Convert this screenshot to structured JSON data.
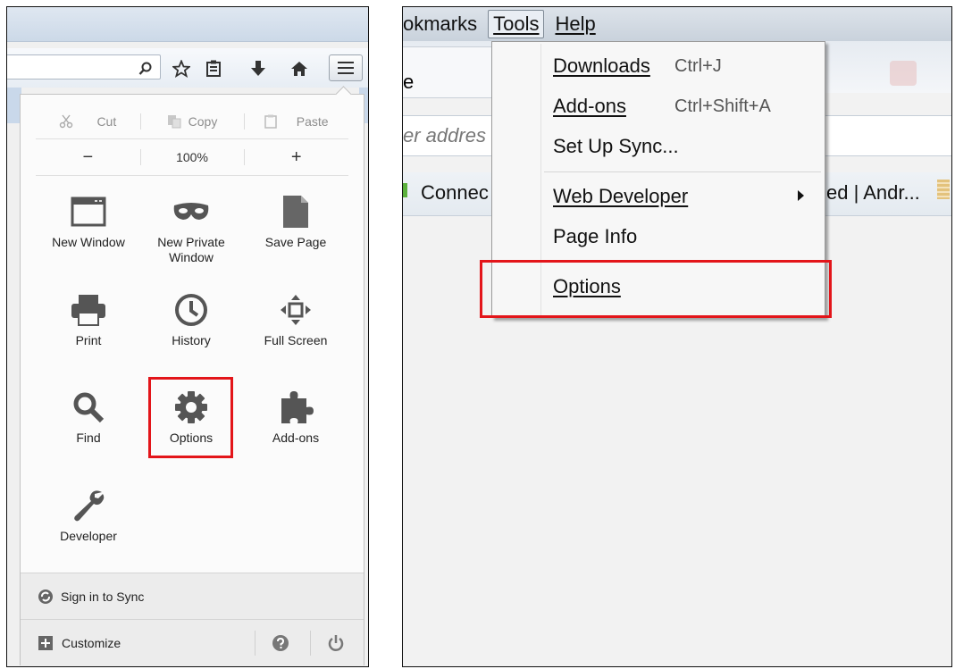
{
  "left_menu": {
    "edit": {
      "cut": "Cut",
      "copy": "Copy",
      "paste": "Paste"
    },
    "zoom": {
      "minus": "−",
      "level": "100%",
      "plus": "+"
    },
    "tiles": [
      {
        "label": "New Window",
        "icon": "window-icon"
      },
      {
        "label": "New Private Window",
        "icon": "mask-icon"
      },
      {
        "label": "Save Page",
        "icon": "page-icon"
      },
      {
        "label": "Print",
        "icon": "printer-icon"
      },
      {
        "label": "History",
        "icon": "clock-icon"
      },
      {
        "label": "Full Screen",
        "icon": "fullscreen-icon"
      },
      {
        "label": "Find",
        "icon": "magnifier-icon"
      },
      {
        "label": "Options",
        "icon": "gear-icon"
      },
      {
        "label": "Add-ons",
        "icon": "puzzle-icon"
      },
      {
        "label": "Developer",
        "icon": "wrench-icon"
      }
    ],
    "sync": "Sign in to Sync",
    "customize": "Customize"
  },
  "right_menu": {
    "menubar": {
      "bookmarks_partial": "okmarks",
      "tools": "Tools",
      "help": "Help"
    },
    "tab_partial": "e",
    "address_partial": "er addres",
    "bookmark_left": "Connec",
    "bookmark_right": "ed | Andr...",
    "items": {
      "downloads": {
        "label": "Downloads",
        "shortcut": "Ctrl+J"
      },
      "addons": {
        "label": "Add-ons",
        "shortcut": "Ctrl+Shift+A"
      },
      "sync": {
        "label": "Set Up Sync..."
      },
      "webdev": {
        "label": "Web Developer"
      },
      "pageinfo": {
        "label": "Page Info"
      },
      "options": {
        "label": "Options"
      }
    }
  },
  "colors": {
    "highlight": "#e3151a"
  }
}
